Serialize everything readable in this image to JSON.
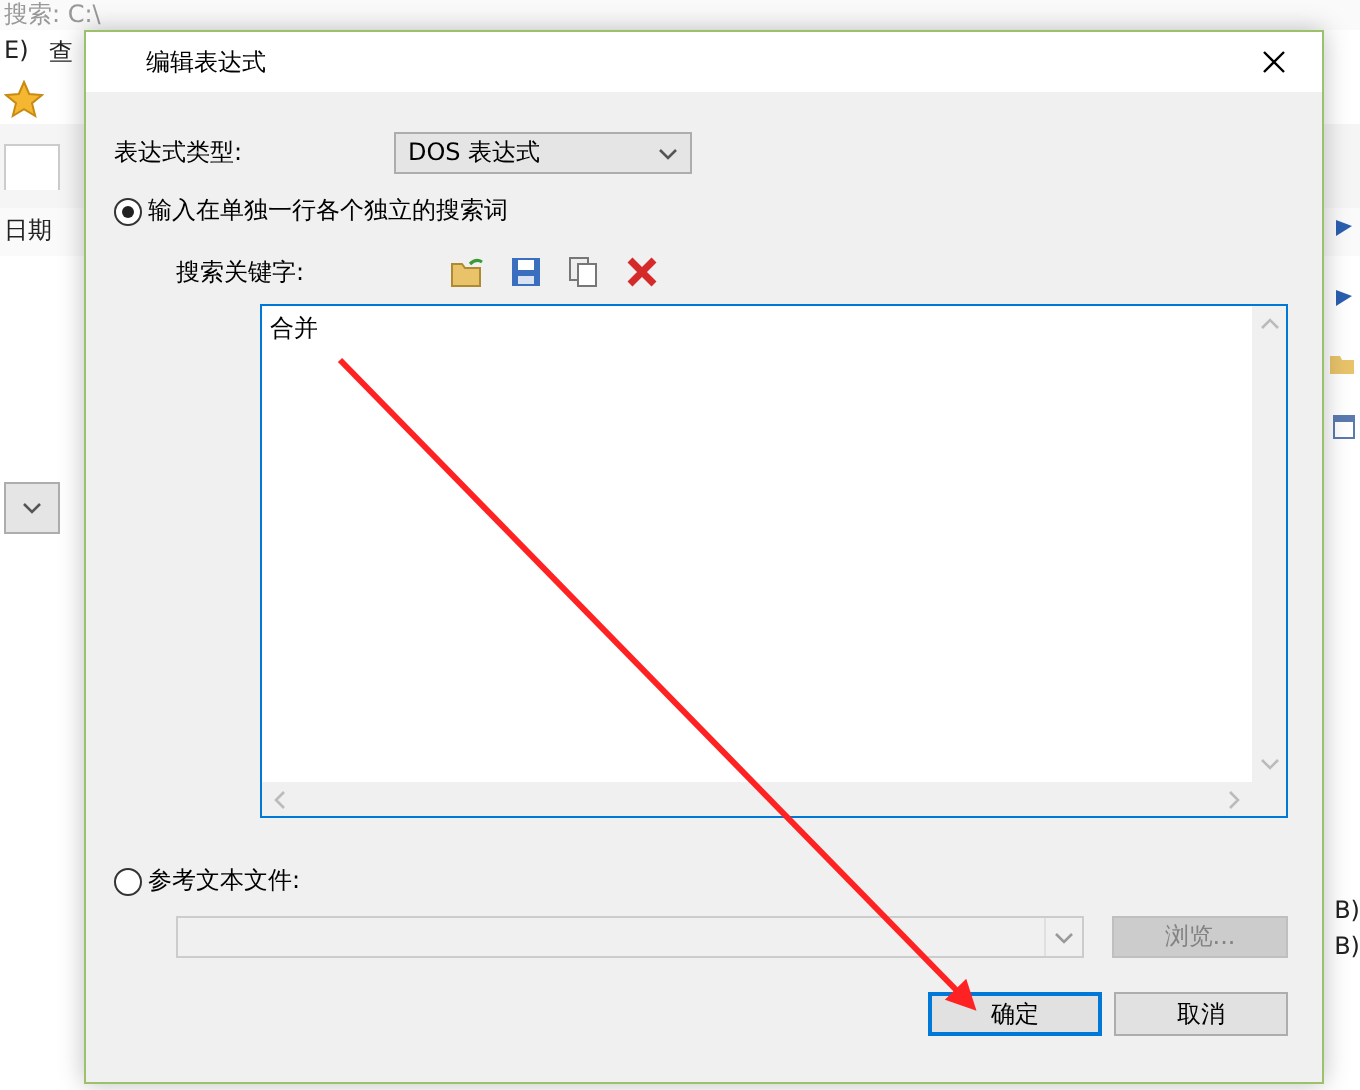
{
  "background_window": {
    "title": "搜索: C:\\",
    "menu": [
      "E)",
      "查"
    ],
    "column_header": "日期",
    "sizes": [
      "B)",
      "B)"
    ]
  },
  "dialog": {
    "title": "编辑表达式",
    "type_label": "表达式类型:",
    "type_value": "DOS 表达式",
    "options": [
      {
        "label": "输入在单独一行各个独立的搜索词",
        "selected": true
      },
      {
        "label": "参考文本文件:",
        "selected": false
      }
    ],
    "keywords_label": "搜索关键字:",
    "keywords": "合并",
    "browse": {
      "label": "浏览...",
      "disabled": true
    },
    "buttons": [
      {
        "label": "确定",
        "focused": true
      },
      {
        "label": "取消",
        "focused": false
      }
    ]
  }
}
